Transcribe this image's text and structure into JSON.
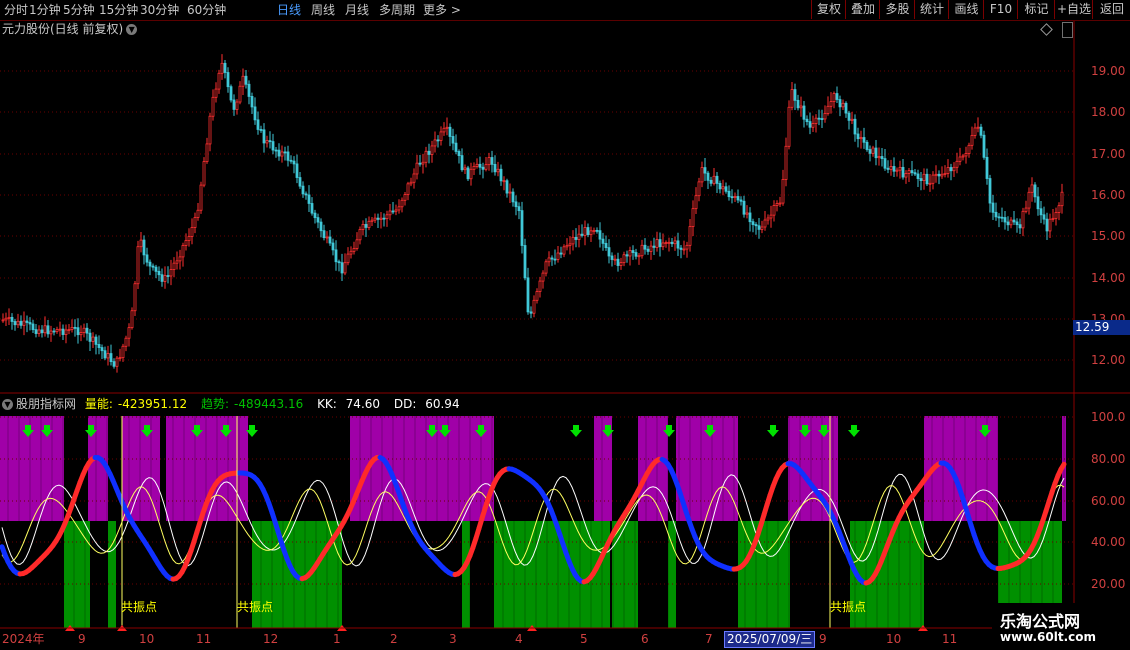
{
  "toolbar": {
    "timeframes": [
      "分时",
      "1分钟",
      "5分钟",
      "15分钟",
      "30分钟",
      "60分钟",
      "日线",
      "周线",
      "月线",
      "多周期",
      "更多 >"
    ],
    "active_timeframe": "日线",
    "right_tools": [
      "复权",
      "叠加",
      "多股",
      "统计",
      "画线",
      "F10",
      "标记",
      "+自选",
      "返回"
    ]
  },
  "main_chart": {
    "stock_title": "元力股份(日线 前复权)",
    "y_ticks": [
      "19.00",
      "18.00",
      "17.00",
      "16.00",
      "15.00",
      "14.00",
      "13.00",
      "12.00"
    ],
    "current_price": "12.59"
  },
  "indicator": {
    "name": "股朋指标网",
    "values": [
      {
        "label": "量能:",
        "value": "-423951.12",
        "color": "#ffff00"
      },
      {
        "label": "趋势:",
        "value": "-489443.16",
        "color": "#00c000"
      },
      {
        "label": "KK:",
        "value": "74.60",
        "color": "#ffffff"
      },
      {
        "label": "DD:",
        "value": "60.94",
        "color": "#ffffff"
      }
    ],
    "y_ticks": [
      "100.0",
      "80.00",
      "60.00",
      "40.00",
      "20.00"
    ],
    "annotations": [
      "共振点",
      "共振点",
      "共振点"
    ]
  },
  "x_axis": {
    "labels": [
      "2024年",
      "9",
      "10",
      "11",
      "12",
      "1",
      "2",
      "3",
      "4",
      "5",
      "6",
      "7",
      "9",
      "10",
      "11"
    ],
    "crosshair_date": "2025/07/09/三"
  },
  "watermark": {
    "line1": "乐淘公式网",
    "line2": "www.60lt.com"
  },
  "colors": {
    "up": "#ff3030",
    "down": "#40c8d8",
    "purple": "#a000a8",
    "green": "#009000",
    "axis": "#d04040",
    "active": "#4a9cff"
  }
}
